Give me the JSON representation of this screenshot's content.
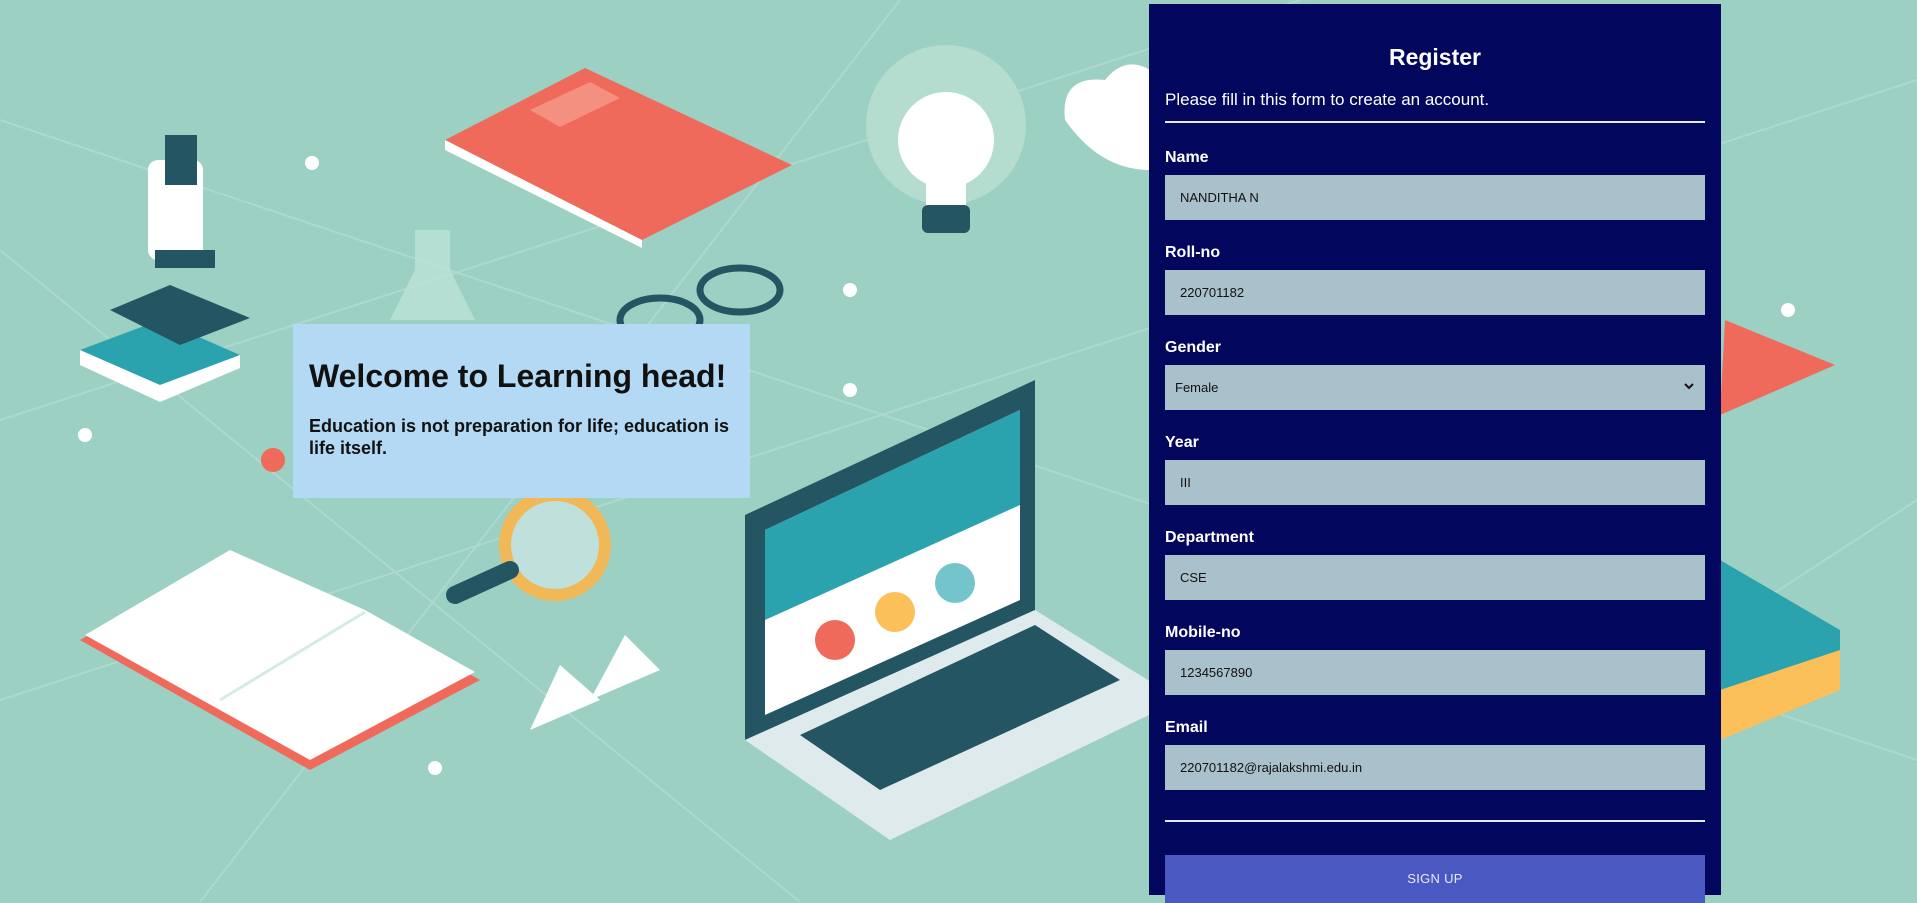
{
  "welcome": {
    "title": "Welcome to Learning head!",
    "quote": "Education is not preparation for life; education is life itself."
  },
  "form": {
    "title": "Register",
    "subtitle": "Please fill in this form to create an account.",
    "fields": [
      {
        "label": "Name",
        "value": "NANDITHA N"
      },
      {
        "label": "Roll-no",
        "value": "220701182"
      },
      {
        "label": "Gender",
        "value": "Female"
      },
      {
        "label": "Year",
        "value": "III"
      },
      {
        "label": "Department",
        "value": "CSE"
      },
      {
        "label": "Mobile-no",
        "value": "1234567890"
      },
      {
        "label": "Email",
        "value": "220701182@rajalakshmi.edu.in"
      }
    ],
    "submit_label": "SIGN UP"
  },
  "colors": {
    "background": "#9bd0c3",
    "panel": "#02075d",
    "input": "#a9c1cb",
    "button": "#4a58c2",
    "welcome_card": "#b3d9f5"
  },
  "icons": [
    "chevron-down-icon"
  ]
}
